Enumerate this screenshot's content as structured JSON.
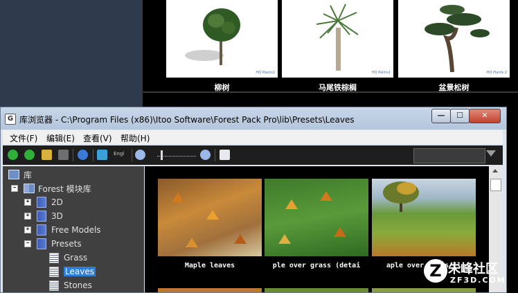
{
  "top_gallery": {
    "items": [
      {
        "label": "柳树",
        "watermark": "HQ Plants1"
      },
      {
        "label": "马尾铁棕榈",
        "watermark": "HQ Palms1"
      },
      {
        "label": "盆景松树",
        "watermark": "HQ Plants 2"
      }
    ]
  },
  "window": {
    "app_icon": "G",
    "title": "库浏览器 - C:\\Program Files (x86)\\Itoo Software\\Forest Pack Pro\\lib\\Presets\\Leaves",
    "minimize": "—",
    "maximize": "☐",
    "close": "✕"
  },
  "menu": {
    "items": [
      "文件(F)",
      "编辑(E)",
      "查看(V)",
      "帮助(H)"
    ]
  },
  "toolbar": {
    "lang_label": "Engl",
    "icons": [
      "back-icon",
      "forward-icon",
      "open-folder-icon",
      "save-icon",
      "refresh-icon",
      "sort-icon",
      "language-icon",
      "zoom-out-icon",
      "zoom-slider",
      "zoom-in-icon",
      "checklist-icon",
      "filter-icon"
    ],
    "search_value": ""
  },
  "tree": {
    "root": "库",
    "library": "Forest 模块库",
    "folders": [
      "2D",
      "3D",
      "Free Models",
      "Presets"
    ],
    "preset_children": [
      "Grass",
      "Leaves",
      "Stones"
    ],
    "selected": "Leaves"
  },
  "thumbnails": [
    {
      "label": "Maple leaves"
    },
    {
      "label": "ple over grass (detai"
    },
    {
      "label": "aple over grass (l"
    }
  ],
  "watermark": {
    "logo": "Z",
    "cn": "朱峰社区",
    "en": "ZF3D.COM"
  },
  "colors": {
    "tree_bg": "#404040",
    "selection": "#2f7fd8",
    "toolbar_bg": "#1e1e1e",
    "titlebar": "#c8d6e8"
  }
}
